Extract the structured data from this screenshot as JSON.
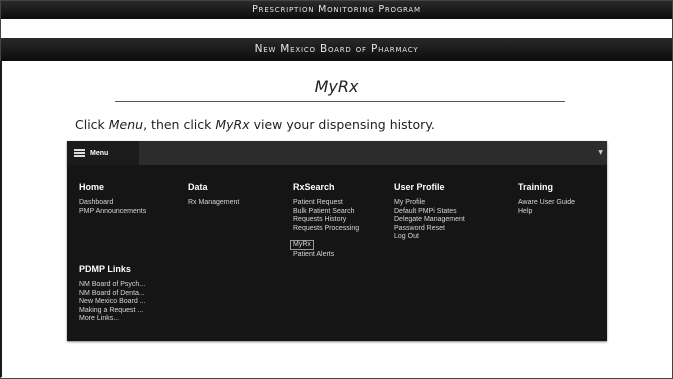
{
  "header": {
    "line1": "Prescription Monitoring Program",
    "line2": "New Mexico Board of Pharmacy"
  },
  "slide": {
    "title": "MyRx",
    "instruction_parts": [
      "Click ",
      "Menu",
      ", then click ",
      "MyRx",
      " view your dispensing history."
    ]
  },
  "app": {
    "menu_label": "Menu",
    "caret_icon": "caret-down-icon",
    "columns": {
      "home": {
        "heading": "Home",
        "items": [
          "Dashboard",
          "PMP Announcements"
        ]
      },
      "data": {
        "heading": "Data",
        "items": [
          "Rx Management"
        ]
      },
      "rxsearch": {
        "heading": "RxSearch",
        "items": [
          "Patient Request",
          "Bulk Patient Search",
          "Requests History",
          "Requests Processing",
          "MyRx",
          "Patient Alerts"
        ]
      },
      "profile": {
        "heading": "User Profile",
        "items": [
          "My Profile",
          "Default PMPi States",
          "Delegate Management",
          "Password Reset",
          "Log Out"
        ]
      },
      "training": {
        "heading": "Training",
        "items": [
          "Aware User Guide",
          "Help"
        ]
      },
      "pdmp": {
        "heading": "PDMP Links",
        "items": [
          "NM Board of Psych...",
          "NM Board of Denta...",
          "New Mexico Board ...",
          "Making a Request ...",
          "More Links..."
        ]
      }
    }
  }
}
